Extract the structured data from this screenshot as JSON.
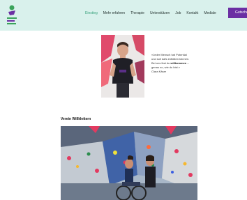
{
  "header": {
    "logo_icon": "organization-logo",
    "nav": [
      {
        "label": "Einstieg",
        "active": true
      },
      {
        "label": "Mehr erfahren"
      },
      {
        "label": "Therapie"
      },
      {
        "label": "Unterstützen"
      },
      {
        "label": "Job"
      },
      {
        "label": "Kontakt"
      },
      {
        "label": "Mediale"
      }
    ],
    "cta_label": "Gutsche"
  },
  "intro": {
    "quote_line1": "«Jeder Mensch hat Potential",
    "quote_line2": "und soll dafs entfalten können.",
    "quote_line3_pre": "Bei uns lbst du ",
    "quote_line3_bold": "willkommen",
    "quote_line3_post": " –",
    "quote_line4": "genau so, wie du bist.»",
    "quote_author": "Clara Käser"
  },
  "section": {
    "title": "Verein Willklettern"
  },
  "colors": {
    "header_bg": "#d9f1ec",
    "accent_green": "#35a07a",
    "cta_purple": "#6b2fa3"
  }
}
